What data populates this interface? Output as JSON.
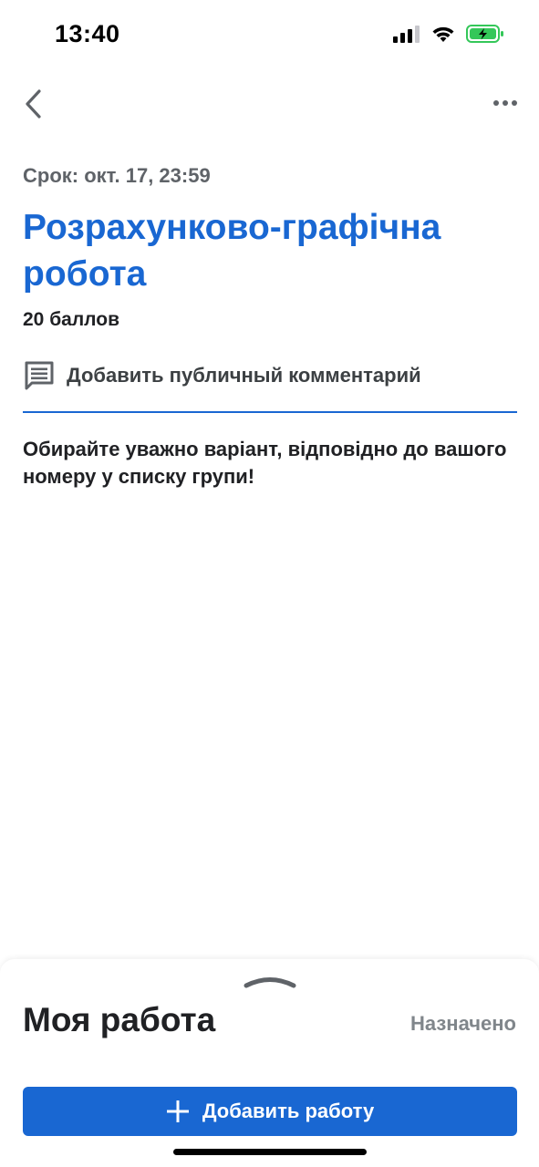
{
  "status_bar": {
    "time": "13:40",
    "icons": [
      "cellular-signal-icon",
      "wifi-icon",
      "battery-charging-icon"
    ],
    "battery_color": "#34c759"
  },
  "top_bar": {
    "back_icon": "chevron-left-icon",
    "more_icon": "more-horizontal-icon"
  },
  "assignment": {
    "due_date": "Срок: окт. 17, 23:59",
    "title": "Розрахунково-графічна робота",
    "points": "20 баллов",
    "comment_label": "Добавить публичный комментарий",
    "comment_icon": "comment-icon",
    "description": "Обирайте уважно варіант, відповідно до вашого номеру у списку групи!"
  },
  "my_work": {
    "handle_icon": "chevron-up-icon",
    "title": "Моя работа",
    "status": "Назначено",
    "add_button_label": "Добавить работу",
    "add_icon": "plus-icon"
  },
  "colors": {
    "accent": "#1967d2",
    "muted_text": "#5f6368",
    "status_text": "#80868b"
  }
}
